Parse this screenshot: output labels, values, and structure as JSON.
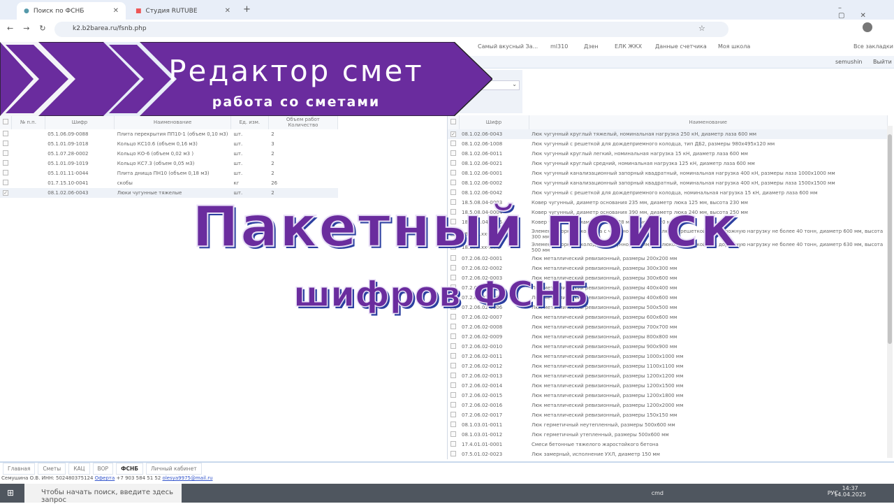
{
  "browser": {
    "tabs": [
      {
        "title": "Поиск по ФСНБ"
      },
      {
        "title": "Студия RUTUBE"
      }
    ],
    "url": "k2.b2barea.ru/fsnb.php",
    "bookmarks": [
      "Самый вкусный За...",
      "ml310",
      "Дзен",
      "ЕЛК ЖКХ",
      "Данные счетчика",
      "Моя школа"
    ],
    "all_bookmarks": "Все закладки"
  },
  "app": {
    "user": "semushin",
    "logout": "Выйти"
  },
  "banner": {
    "title": "Редактор смет",
    "subtitle": "работа со сметами"
  },
  "overlay": {
    "line1": "Пакетный поиск",
    "line2": "шифров ФСНБ"
  },
  "left_table": {
    "headers": [
      "№ п.п.",
      "Шифр",
      "Наименование",
      "Ед. изм.",
      "Объем работ Количество"
    ],
    "rows": [
      {
        "checked": false,
        "code": "05.1.06.09-0088",
        "name": "Плита перекрытия ПП10-1 (объем 0,10 м3)",
        "unit": "шт.",
        "qty": "2"
      },
      {
        "checked": false,
        "code": "05.1.01.09-1018",
        "name": "Кольцо КС10.6 (объем 0,16 м3)",
        "unit": "шт.",
        "qty": "3"
      },
      {
        "checked": false,
        "code": "05.1.07.28-0002",
        "name": "Кольцо КО-6 (объем 0,02 м3 )",
        "unit": "шт.",
        "qty": "2"
      },
      {
        "checked": false,
        "code": "05.1.01.09-1019",
        "name": "Кольцо КС7.3 (объем 0,05 м3)",
        "unit": "шт.",
        "qty": "2"
      },
      {
        "checked": false,
        "code": "05.1.01.11-0044",
        "name": "Плита днища ПН10 (объем 0,18 м3)",
        "unit": "шт.",
        "qty": "2"
      },
      {
        "checked": false,
        "code": "01.7.15.10-0041",
        "name": "скобы",
        "unit": "кг",
        "qty": "26"
      },
      {
        "checked": true,
        "code": "08.1.02.06-0043",
        "name": "Люки чугунные тяжелые",
        "unit": "шт.",
        "qty": "2"
      }
    ]
  },
  "right_table": {
    "headers": [
      "Шифр",
      "Наименование"
    ],
    "rows": [
      {
        "checked": true,
        "code": "08.1.02.06-0043",
        "name": "Люк чугунный круглый тяжелый, номинальная нагрузка 250 кН, диаметр лаза 600 мм"
      },
      {
        "code": "08.1.02.06-1008",
        "name": "Люк чугунный с решеткой для дождеприемного колодца, тип ДБ2, размеры 980x495x120 мм"
      },
      {
        "code": "08.1.02.06-0011",
        "name": "Люк чугунный круглый легкий, номинальная нагрузка 15 кН, диаметр лаза 600 мм"
      },
      {
        "code": "08.1.02.06-0021",
        "name": "Люк чугунный круглый средний, номинальная нагрузка 125 кН, диаметр лаза 600 мм"
      },
      {
        "code": "08.1.02.06-0001",
        "name": "Люк чугунный канализационный запорный квадратный, номинальная нагрузка 400 кН, размеры лаза 1000x1000 мм"
      },
      {
        "code": "08.1.02.06-0002",
        "name": "Люк чугунный канализационный запорный квадратный, номинальная нагрузка 400 кН, размеры лаза 1500x1500 мм"
      },
      {
        "code": "08.1.02.06-0042",
        "name": "Люк чугунный с решеткой для дождеприемного колодца, номинальная нагрузка 15 кН, диаметр лаза 600 мм"
      },
      {
        "code": "18.5.08.04-0003",
        "name": "Ковер чугунный, диаметр основания 235 мм, диаметр люка 125 мм, высота 230 мм"
      },
      {
        "code": "18.5.08.04-0004",
        "name": "Ковер чугунный, диаметр основания 390 мм, диаметр люка 240 мм, высота 250 мм"
      },
      {
        "code": "18.5.08.04-0005",
        "name": "Ковер чугунный, диаметр люка 228 мм, высота 220 мм"
      },
      {
        "code": "18.x.xx.xx-xxx1",
        "tall": true,
        "name": "Элемент сборного колодца с чугунной обоймой и люком-решеткой под дорожную нагрузку не более 40 тонн, диаметр 600 мм, высота 300 мм"
      },
      {
        "code": "18.x.xx.xx-xxx2",
        "tall": true,
        "name": "Элемент сборного колодца с чугунной обоймой и люком-решеткой под дорожную нагрузку не более 40 тонн, диаметр 630 мм, высота 500 мм"
      },
      {
        "code": "07.2.06.02-0001",
        "name": "Люк металлический ревизионный, размеры 200x200 мм"
      },
      {
        "code": "07.2.06.02-0002",
        "name": "Люк металлический ревизионный, размеры 300x300 мм"
      },
      {
        "code": "07.2.06.02-0003",
        "name": "Люк металлический ревизионный, размеры 300x600 мм"
      },
      {
        "code": "07.2.06.02-0004",
        "name": "Люк металлический ревизионный, размеры 400x400 мм"
      },
      {
        "code": "07.2.06.02-0005",
        "name": "Люк металлический ревизионный, размеры 400x600 мм"
      },
      {
        "code": "07.2.06.02-0006",
        "name": "Люк металлический ревизионный, размеры 500x500 мм"
      },
      {
        "code": "07.2.06.02-0007",
        "name": "Люк металлический ревизионный, размеры 600x600 мм"
      },
      {
        "code": "07.2.06.02-0008",
        "name": "Люк металлический ревизионный, размеры 700x700 мм"
      },
      {
        "code": "07.2.06.02-0009",
        "name": "Люк металлический ревизионный, размеры 800x800 мм"
      },
      {
        "code": "07.2.06.02-0010",
        "name": "Люк металлический ревизионный, размеры 900x900 мм"
      },
      {
        "code": "07.2.06.02-0011",
        "name": "Люк металлический ревизионный, размеры 1000x1000 мм"
      },
      {
        "code": "07.2.06.02-0012",
        "name": "Люк металлический ревизионный, размеры 1100x1100 мм"
      },
      {
        "code": "07.2.06.02-0013",
        "name": "Люк металлический ревизионный, размеры 1200x1200 мм"
      },
      {
        "code": "07.2.06.02-0014",
        "name": "Люк металлический ревизионный, размеры 1200x1500 мм"
      },
      {
        "code": "07.2.06.02-0015",
        "name": "Люк металлический ревизионный, размеры 1200x1800 мм"
      },
      {
        "code": "07.2.06.02-0016",
        "name": "Люк металлический ревизионный, размеры 1200x2000 мм"
      },
      {
        "code": "07.2.06.02-0017",
        "name": "Люк металлический ревизионный, размеры 150x150 мм"
      },
      {
        "code": "08.1.03.01-0011",
        "name": "Люк герметичный неутепленный, размеры 500x600 мм"
      },
      {
        "code": "08.1.03.01-0012",
        "name": "Люк герметичный утепленный, размеры 500x600 мм"
      },
      {
        "code": "17.4.01.01-0001",
        "name": "Смеси бетонные тяжелого жаростойкого бетона"
      },
      {
        "code": "07.5.01.02-0023",
        "name": "Люк замерный, исполнение УХЛ, диаметр 150 мм"
      }
    ]
  },
  "bottom_tabs": [
    "Главная",
    "Сметы",
    "КАЦ",
    "ВОР",
    "ФСНБ",
    "Личный кабинет"
  ],
  "status": {
    "text": "Семушина О.В. ИНН: 502480375124",
    "offer": "Оферта",
    "phone": "+7 903 584 51 52",
    "email": "olesya9975@mail.ru"
  },
  "taskbar": {
    "search_placeholder": "Чтобы начать поиск, введите здесь запрос",
    "cmd": "cmd",
    "lang": "РУС",
    "time": "14:37",
    "date": "14.04.2025"
  }
}
